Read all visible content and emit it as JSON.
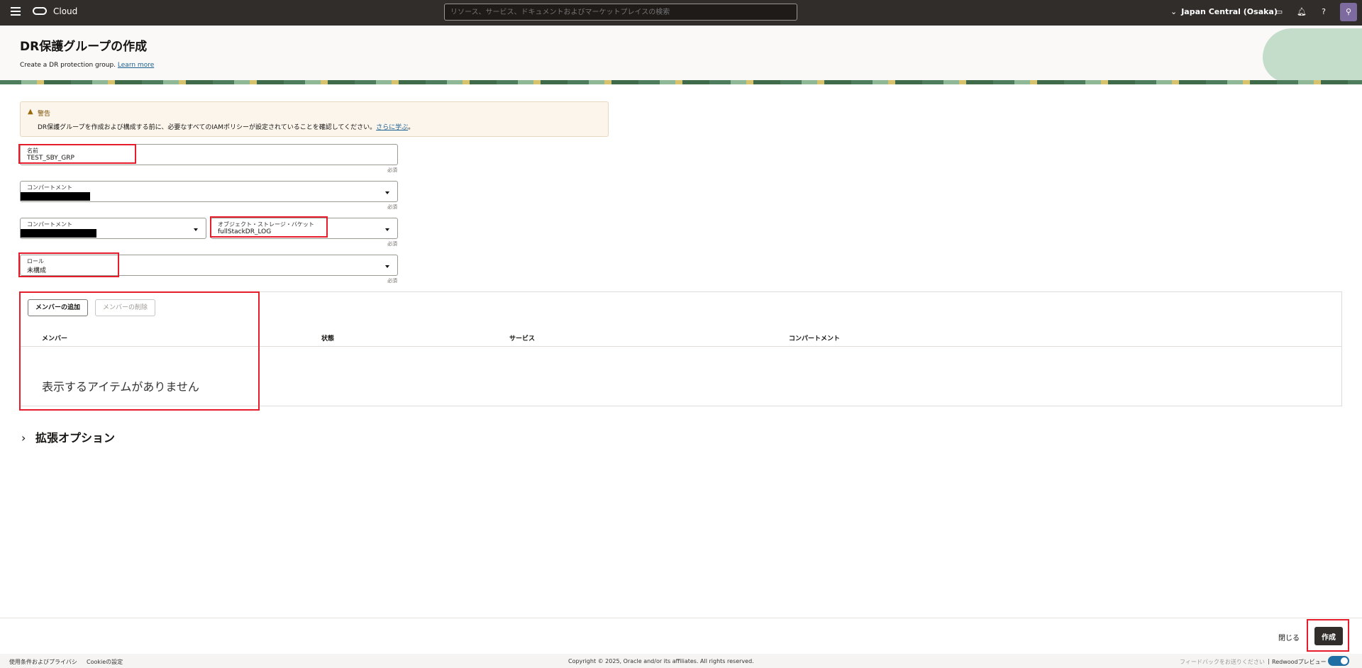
{
  "topbar": {
    "brand": "Cloud",
    "search_placeholder": "リソース、サービス、ドキュメントおよびマーケットプレイスの検索",
    "region": "Japan Central (Osaka)",
    "icons": [
      "menu-icon",
      "console-icon",
      "bell-icon",
      "help-icon",
      "user-icon"
    ]
  },
  "header": {
    "title": "DR保護グループの作成",
    "subtitle": "Create a DR protection group.",
    "learn_more": "Learn more"
  },
  "warning": {
    "title": "警告",
    "text": "DR保護グループを作成および構成する前に、必要なすべてのIAMポリシーが設定されていることを確認してください。",
    "link": "さらに学ぶ",
    "suffix": "。"
  },
  "form": {
    "name_label": "名前",
    "name_value": "TEST_SBY_GRP",
    "compartment_label": "コンパートメント",
    "bucket_compartment_label": "コンパートメント",
    "bucket_label": "オブジェクト・ストレージ・バケット",
    "bucket_value": "fullStackDR_LOG",
    "role_label": "ロール",
    "role_value": "未構成",
    "required": "必須"
  },
  "members": {
    "add_button": "メンバーの追加",
    "remove_button": "メンバーの削除",
    "columns": [
      "メンバー",
      "状態",
      "サービス",
      "コンパートメント"
    ],
    "empty_text": "表示するアイテムがありません"
  },
  "advanced": {
    "label": "拡張オプション"
  },
  "actions": {
    "close": "閉じる",
    "create": "作成"
  },
  "footer": {
    "terms": "使用条件およびプライバシ",
    "cookie": "Cookieの設定",
    "copyright": "Copyright © 2025, Oracle and/or its affiliates. All rights reserved.",
    "feedback": "フィードバックをお送りください",
    "separator": "|",
    "redwood": "Redwoodプレビュー"
  },
  "colors": {
    "highlight": "#e41c2b",
    "topbar": "#312d2a",
    "primary_button": "#312d2a"
  }
}
